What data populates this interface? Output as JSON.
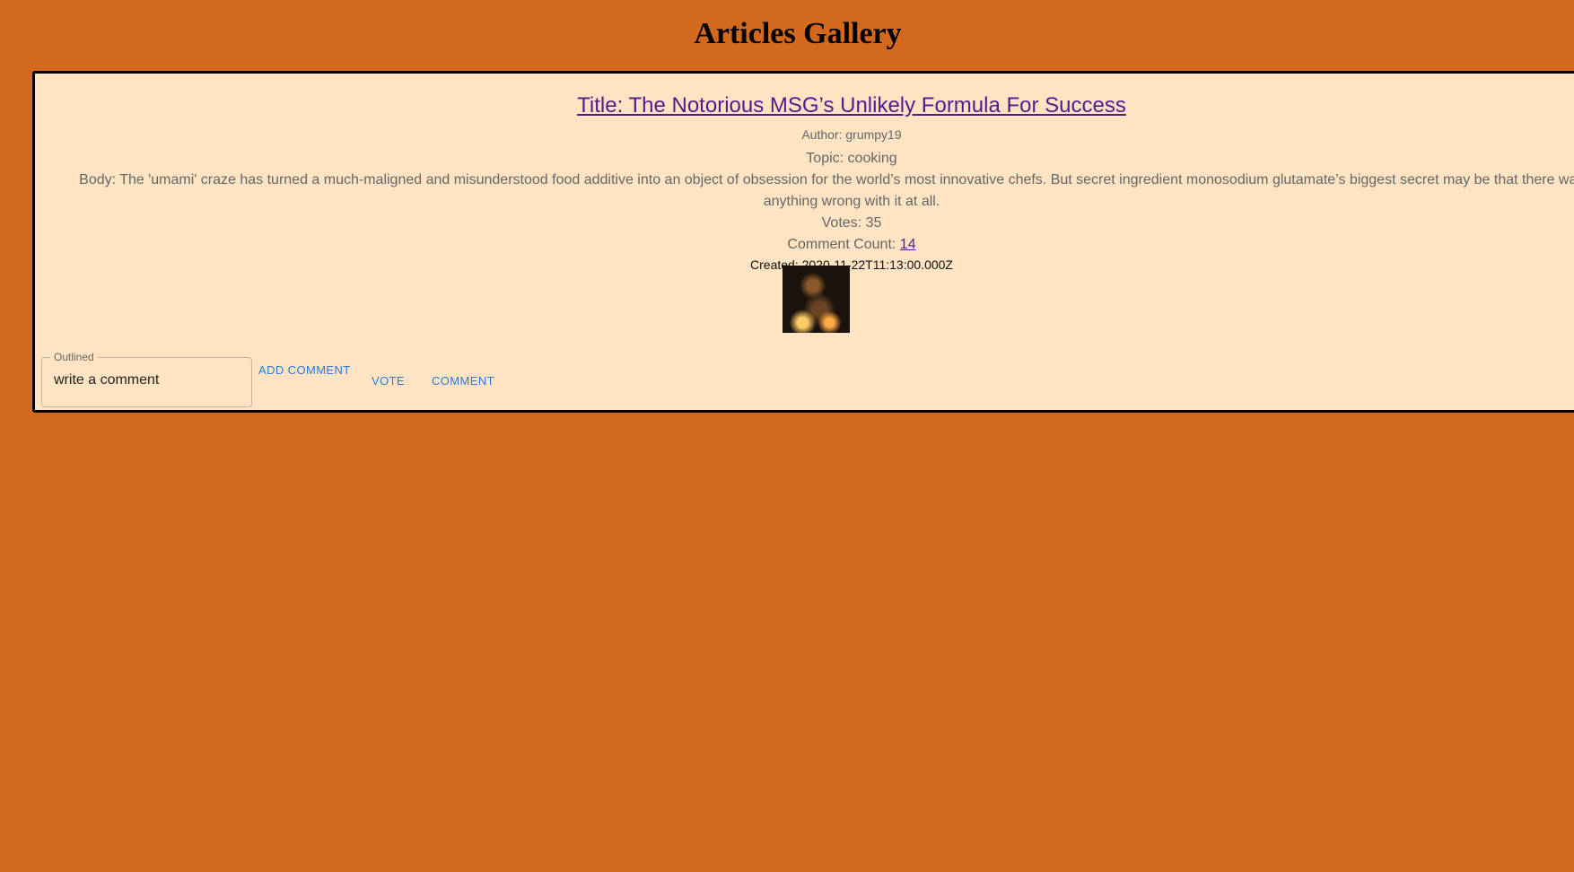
{
  "page": {
    "title": "Articles Gallery",
    "background_color": "#d2691e"
  },
  "article": {
    "title": "Title: The Notorious MSG’s Unlikely Formula For Success",
    "author": "Author: grumpy19",
    "topic": "Topic: cooking",
    "body": "Body: The 'umami' craze has turned a much-maligned and misunderstood food additive into an object of obsession for the world’s most innovative chefs. But secret ingredient monosodium glutamate’s biggest secret may be that there was never anything wrong with it at all.",
    "votes": "Votes: 35",
    "comment_count_label": "Comment Count: ",
    "comment_count": "14",
    "created": "Created: 2020-11-22T11:13:00.000Z",
    "card_color": "#ffe4c4",
    "link_color": "#551a8b"
  },
  "comment_form": {
    "field_label": "Outlined",
    "placeholder": "write a comment",
    "add_button": "ADD COMMENT"
  },
  "actions": {
    "vote": "VOTE",
    "comment": "COMMENT",
    "button_color": "#2f7bd6"
  }
}
